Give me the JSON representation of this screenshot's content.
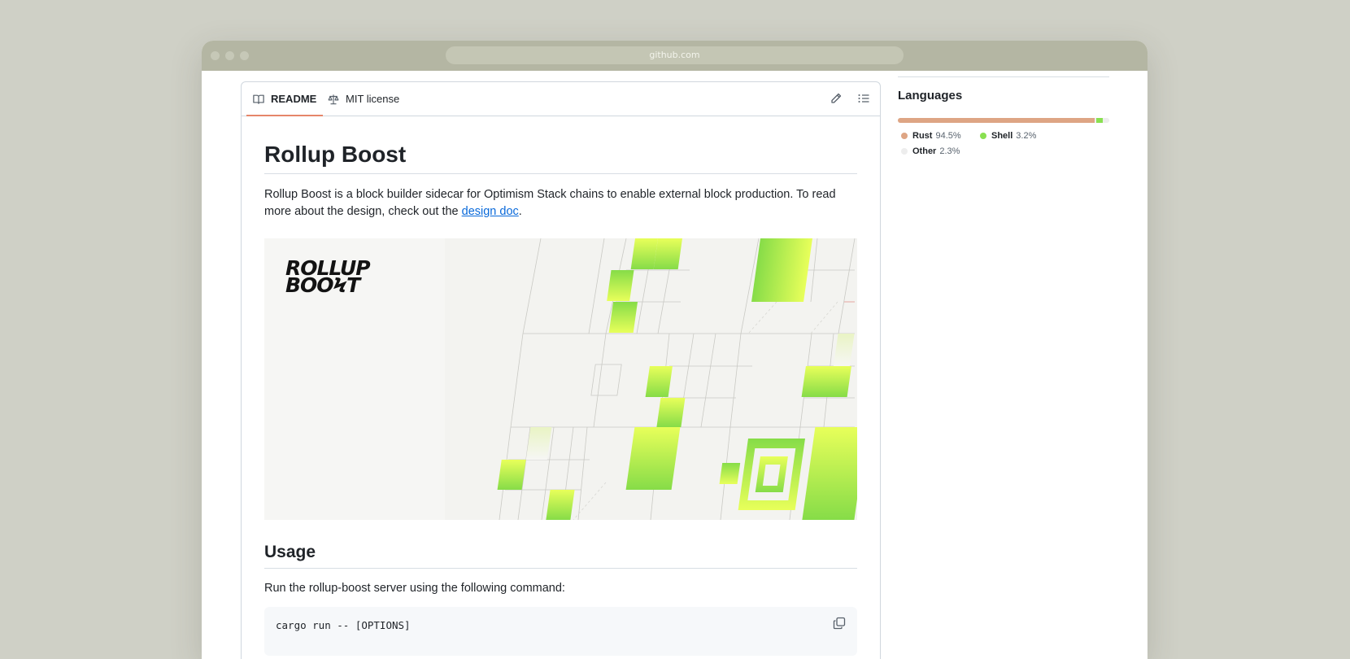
{
  "browser": {
    "url": "github.com"
  },
  "tabs": [
    {
      "label": "README",
      "icon": "book-icon",
      "active": true
    },
    {
      "label": "MIT license",
      "icon": "scale-icon",
      "active": false
    }
  ],
  "tab_actions": [
    {
      "icon": "pencil-icon"
    },
    {
      "icon": "list-unordered-icon"
    }
  ],
  "readme": {
    "title": "Rollup Boost",
    "intro_text": "Rollup Boost is a block builder sidecar for Optimism Stack chains to enable external block production. To read more about the design, check out the ",
    "intro_link": "design doc",
    "intro_end": ".",
    "banner_logo_line1": "ROLLUP",
    "banner_logo_line2": "BOOϞT",
    "usage_heading": "Usage",
    "usage_text": "Run the rollup-boost server using the following command:",
    "code": "cargo run -- [OPTIONS]"
  },
  "sidebar": {
    "languages_heading": "Languages",
    "languages": [
      {
        "name": "Rust",
        "percent": "94.5%",
        "value": 94.5,
        "color": "#dea584"
      },
      {
        "name": "Shell",
        "percent": "3.2%",
        "value": 3.2,
        "color": "#89e051"
      },
      {
        "name": "Other",
        "percent": "2.3%",
        "value": 2.3,
        "color": "#ededed"
      }
    ]
  },
  "colors": {
    "accent": "#e6866a",
    "link": "#0969da",
    "banner_green": "#8be04d",
    "banner_yellow": "#e8ff5a"
  }
}
